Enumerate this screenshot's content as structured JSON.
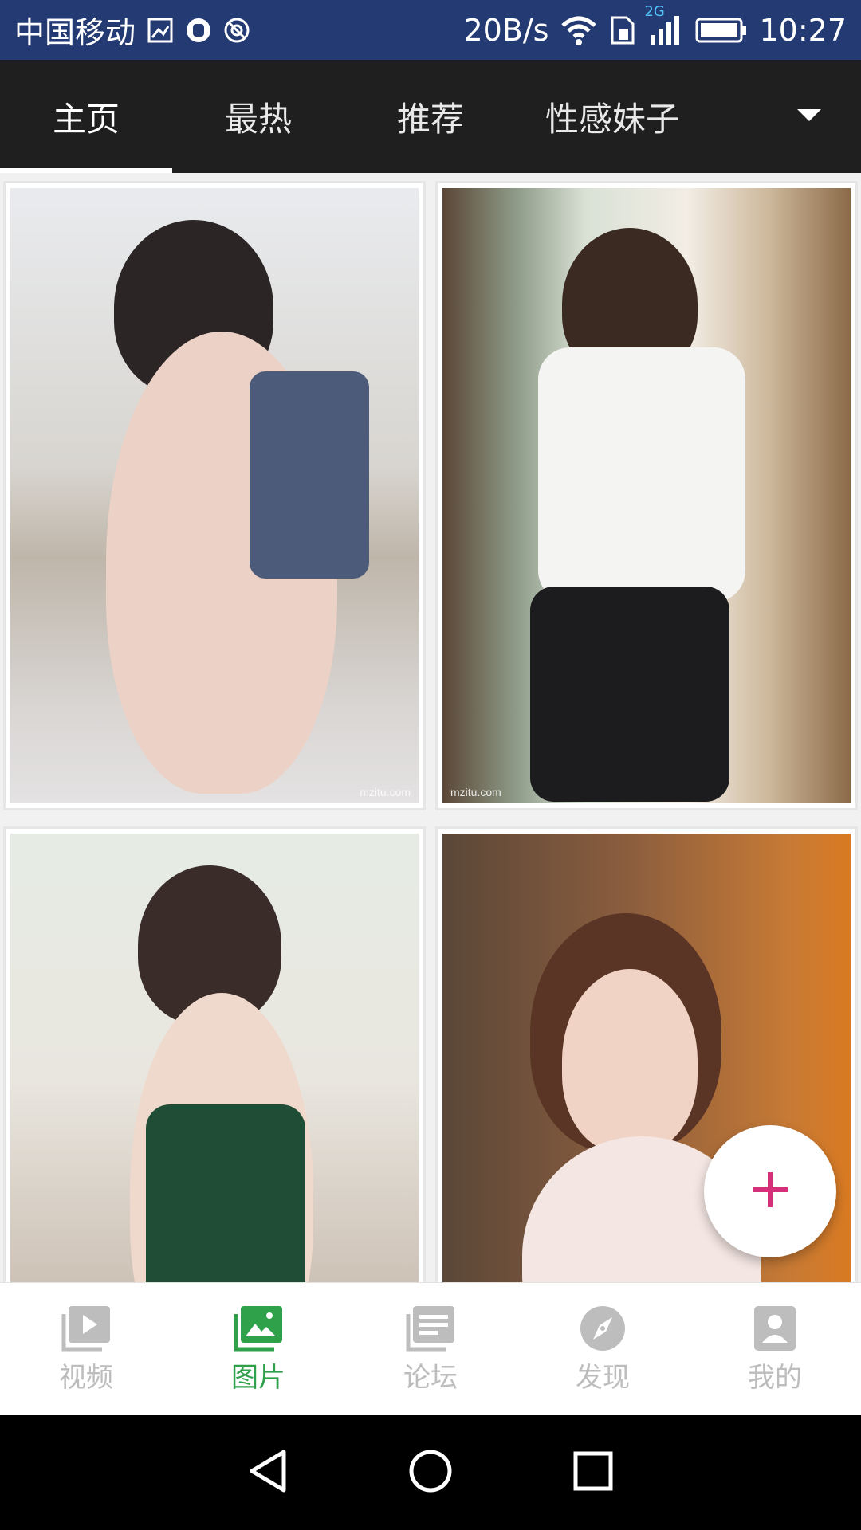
{
  "status_bar": {
    "carrier": "中国移动",
    "network_speed": "20B/s",
    "network_type": "2G",
    "time": "10:27",
    "icons": [
      "image-icon",
      "hand-icon",
      "circle-icon",
      "wifi-icon",
      "sim-icon",
      "signal-icon",
      "battery-icon"
    ]
  },
  "top_tabs": {
    "items": [
      {
        "label": "主页",
        "active": true
      },
      {
        "label": "最热",
        "active": false
      },
      {
        "label": "推荐",
        "active": false
      },
      {
        "label": "性感妹子",
        "active": false
      }
    ],
    "more_icon": "dropdown-arrow-icon"
  },
  "gallery": {
    "items": [
      {
        "watermark": "mzitu.com"
      },
      {
        "watermark": "mzitu.com"
      },
      {
        "watermark": ""
      },
      {
        "watermark": ""
      }
    ]
  },
  "fab": {
    "icon": "plus-icon",
    "color": "#d6307a"
  },
  "bottom_nav": {
    "items": [
      {
        "label": "视频",
        "icon": "video-icon",
        "active": false
      },
      {
        "label": "图片",
        "icon": "image-icon",
        "active": true
      },
      {
        "label": "论坛",
        "icon": "forum-icon",
        "active": false
      },
      {
        "label": "发现",
        "icon": "compass-icon",
        "active": false
      },
      {
        "label": "我的",
        "icon": "profile-icon",
        "active": false
      }
    ],
    "active_color": "#2ea14a",
    "inactive_color": "#bdbdbd"
  },
  "system_nav": {
    "icons": [
      "back-icon",
      "home-icon",
      "recents-icon"
    ]
  }
}
